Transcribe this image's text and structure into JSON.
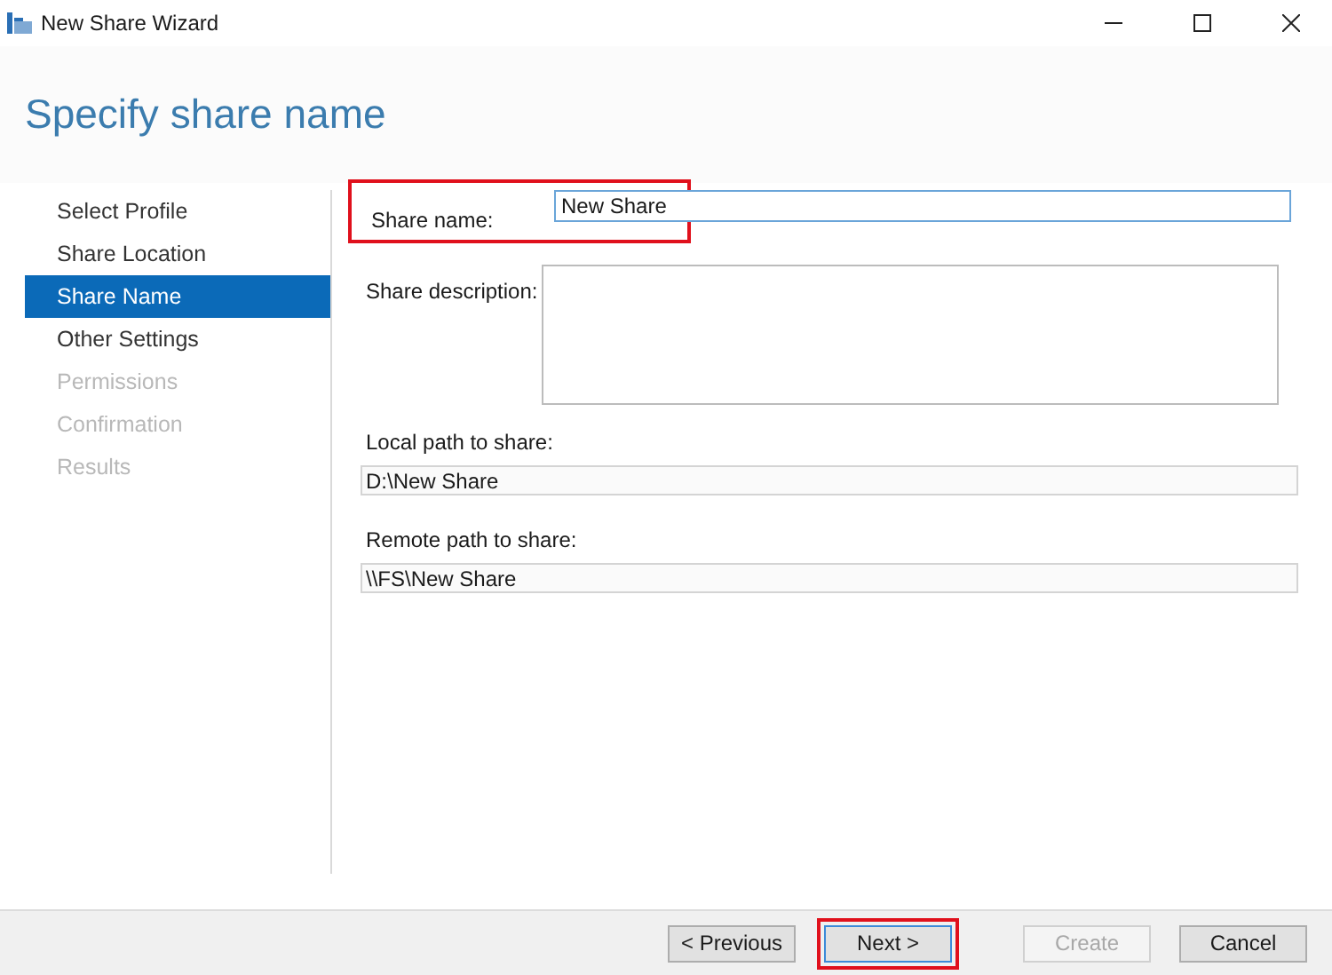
{
  "window": {
    "title": "New Share Wizard"
  },
  "heading": "Specify share name",
  "steps": [
    {
      "label": "Select Profile",
      "selected": false,
      "disabled": false
    },
    {
      "label": "Share Location",
      "selected": false,
      "disabled": false
    },
    {
      "label": "Share Name",
      "selected": true,
      "disabled": false
    },
    {
      "label": "Other Settings",
      "selected": false,
      "disabled": false
    },
    {
      "label": "Permissions",
      "selected": false,
      "disabled": true
    },
    {
      "label": "Confirmation",
      "selected": false,
      "disabled": true
    },
    {
      "label": "Results",
      "selected": false,
      "disabled": true
    }
  ],
  "share_name": {
    "label": "Share name:",
    "value": "New Share",
    "highlighted": true
  },
  "share_description": {
    "label": "Share description:"
  },
  "local_path": {
    "label": "Local path to share:",
    "value": "D:\\New Share"
  },
  "remote_path": {
    "label": "Remote path to share:",
    "value": "\\\\FS\\New Share"
  },
  "buttons": [
    {
      "label": "< Previous",
      "disabled": false,
      "highlighted": false
    },
    {
      "label": "Next >",
      "disabled": false,
      "highlighted": true
    },
    {
      "label": "Create",
      "disabled": true,
      "highlighted": false
    },
    {
      "label": "Cancel",
      "disabled": false,
      "highlighted": false
    }
  ]
}
